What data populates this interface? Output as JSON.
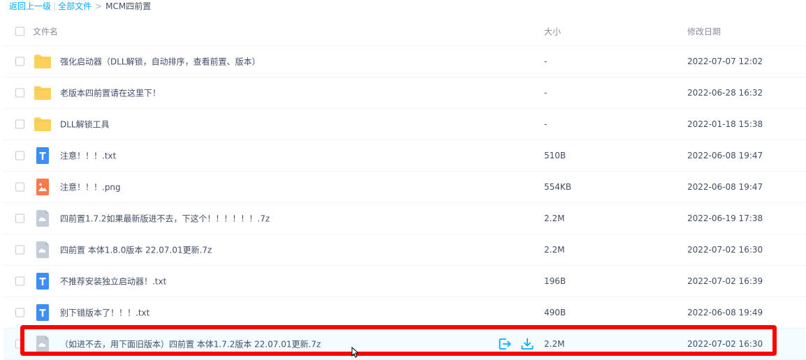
{
  "breadcrumb": {
    "back": "返回上一级",
    "all_files": "全部文件",
    "separator_bar": "|",
    "separator_gt": ">",
    "current": "MCM四前置"
  },
  "header": {
    "name": "文件名",
    "size": "大小",
    "modified": "修改日期"
  },
  "files": [
    {
      "name": "强化启动器（DLL解锁，自动排序，查看前置、版本）",
      "size": "-",
      "modified": "2022-07-07 12:02",
      "icon": "folder-icon"
    },
    {
      "name": "老版本四前置请在这里下！",
      "size": "-",
      "modified": "2022-06-28 16:32",
      "icon": "folder-icon"
    },
    {
      "name": "DLL解锁工具",
      "size": "-",
      "modified": "2022-01-18 15:38",
      "icon": "folder-icon"
    },
    {
      "name": "注意！！！.txt",
      "size": "510B",
      "modified": "2022-06-08 19:47",
      "icon": "text-file-icon"
    },
    {
      "name": "注意！！！.png",
      "size": "554KB",
      "modified": "2022-06-08 19:47",
      "icon": "image-file-icon"
    },
    {
      "name": "四前置1.7.2如果最新版进不去，下这个！！！！！！.7z",
      "size": "2.2M",
      "modified": "2022-06-19 17:38",
      "icon": "archive-file-icon"
    },
    {
      "name": "四前置 本体1.8.0版本 22.07.01更新.7z",
      "size": "2.2M",
      "modified": "2022-07-02 16:30",
      "icon": "archive-file-icon"
    },
    {
      "name": "不推荐安装独立启动器！.txt",
      "size": "196B",
      "modified": "2022-07-02 16:39",
      "icon": "text-file-icon"
    },
    {
      "name": "别下错版本了！！！.txt",
      "size": "490B",
      "modified": "2022-06-08 19:49",
      "icon": "text-file-icon"
    },
    {
      "name": "（如进不去，用下面旧版本）四前置 本体1.7.2版本 22.07.01更新.7z",
      "size": "2.2M",
      "modified": "2022-07-02 16:30",
      "icon": "archive-file-icon",
      "hovered": true
    }
  ],
  "row_actions": [
    "share-icon",
    "download-icon"
  ],
  "colors": {
    "link": "#09aaff",
    "folder": "#ffd05c",
    "text_file": "#3d8ff5",
    "image_file": "#fa7a4c",
    "archive_file": "#c4ccd8",
    "highlight": "#ff0000"
  }
}
